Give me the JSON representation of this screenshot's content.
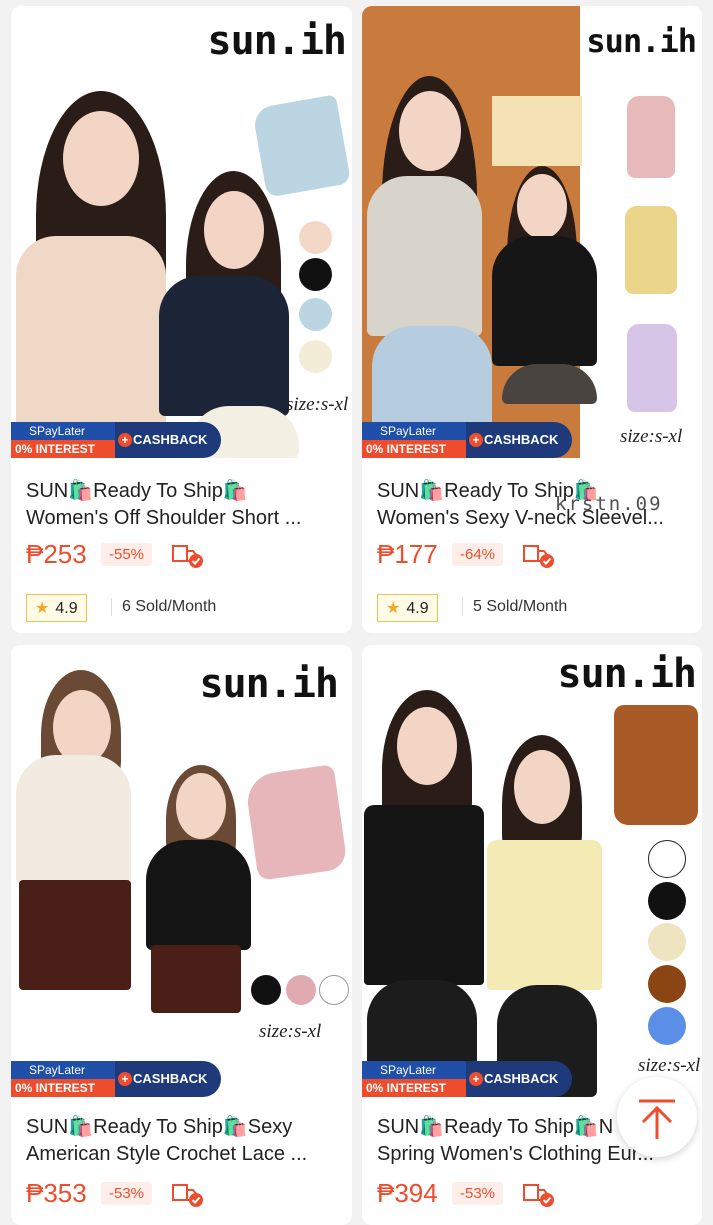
{
  "products": [
    {
      "brand": "sun.ih",
      "size_note": "size:s-xl",
      "swatches": [
        "#f3d8c8",
        "#111111",
        "#bcd5e3",
        "#f3ecd6"
      ],
      "banner": {
        "spaylater": "SPayLater",
        "interest": "0% INTEREST",
        "cashback": "CASHBACK"
      },
      "title_line1": "SUN🛍️Ready To Ship🛍️",
      "title_line2": "Women's Off Shoulder Short ...",
      "price": "₱253",
      "discount": "-55%",
      "rating": "4.9",
      "sold": "6 Sold/Month"
    },
    {
      "brand": "sun.ih",
      "size_note": "size:s-xl",
      "swatches": [
        "#e8b9b9",
        "#ead58a",
        "#d6c5e6"
      ],
      "banner": {
        "spaylater": "SPayLater",
        "interest": "0% INTEREST",
        "cashback": "CASHBACK"
      },
      "title_line1": "SUN🛍️Ready To Ship🛍️",
      "title_line2": "Women's Sexy V-neck Sleevel...",
      "price": "₱177",
      "discount": "-64%",
      "rating": "4.9",
      "sold": "5 Sold/Month"
    },
    {
      "brand": "sun.ih",
      "size_note": "size:s-xl",
      "swatches": [
        "#111111",
        "#e1aab0",
        "#ffffff"
      ],
      "banner": {
        "spaylater": "SPayLater",
        "interest": "0% INTEREST",
        "cashback": "CASHBACK"
      },
      "title_line1": "SUN🛍️Ready To Ship🛍️Sexy",
      "title_line2": "American Style Crochet Lace ...",
      "price": "₱353",
      "discount": "-53%"
    },
    {
      "brand": "sun.ih",
      "size_note": "size:s-xl",
      "swatches": [
        "#ffffff",
        "#111111",
        "#efe4c0",
        "#8b4513",
        "#5b8ee6"
      ],
      "banner": {
        "spaylater": "SPayLater",
        "interest": "0% INTEREST",
        "cashback": "CASHBACK"
      },
      "title_line1": "SUN🛍️Ready To Ship🛍️N",
      "title_line2": "Spring Women's Clothing Eur...",
      "price": "₱394",
      "discount": "-53%"
    }
  ],
  "watermark": "krstn.09",
  "colors": {
    "accent": "#ee4d2d",
    "rating_star": "#f5a623"
  },
  "icons": {
    "back_to_top": "arrow-up-icon",
    "free_shipping": "shipping-check-icon"
  }
}
